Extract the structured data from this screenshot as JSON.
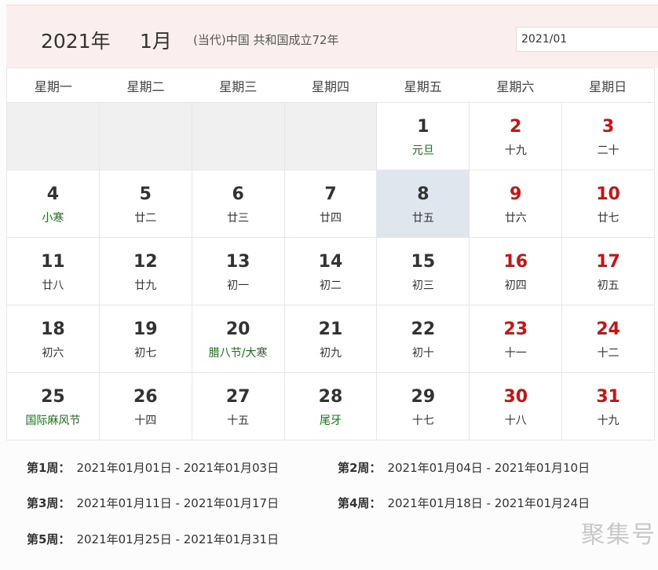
{
  "header": {
    "year": "2021年",
    "month": "1月",
    "era": "(当代)中国 共和国成立72年",
    "picker_value": "2021/01"
  },
  "weekdays": [
    "星期一",
    "星期二",
    "星期三",
    "星期四",
    "星期五",
    "星期六",
    "星期日"
  ],
  "days": [
    {
      "day": "",
      "lunar": ""
    },
    {
      "day": "",
      "lunar": ""
    },
    {
      "day": "",
      "lunar": ""
    },
    {
      "day": "",
      "lunar": ""
    },
    {
      "day": "1",
      "lunar": "元旦",
      "festival": true
    },
    {
      "day": "2",
      "lunar": "十九",
      "weekend": true
    },
    {
      "day": "3",
      "lunar": "二十",
      "weekend": true
    },
    {
      "day": "4",
      "lunar": "小寒",
      "festival": true
    },
    {
      "day": "5",
      "lunar": "廿二"
    },
    {
      "day": "6",
      "lunar": "廿三"
    },
    {
      "day": "7",
      "lunar": "廿四"
    },
    {
      "day": "8",
      "lunar": "廿五",
      "today": true
    },
    {
      "day": "9",
      "lunar": "廿六",
      "weekend": true
    },
    {
      "day": "10",
      "lunar": "廿七",
      "weekend": true
    },
    {
      "day": "11",
      "lunar": "廿八"
    },
    {
      "day": "12",
      "lunar": "廿九"
    },
    {
      "day": "13",
      "lunar": "初一"
    },
    {
      "day": "14",
      "lunar": "初二"
    },
    {
      "day": "15",
      "lunar": "初三"
    },
    {
      "day": "16",
      "lunar": "初四",
      "weekend": true
    },
    {
      "day": "17",
      "lunar": "初五",
      "weekend": true
    },
    {
      "day": "18",
      "lunar": "初六"
    },
    {
      "day": "19",
      "lunar": "初七"
    },
    {
      "day": "20",
      "lunar": "腊八节/大寒",
      "festival": true
    },
    {
      "day": "21",
      "lunar": "初九"
    },
    {
      "day": "22",
      "lunar": "初十"
    },
    {
      "day": "23",
      "lunar": "十一",
      "weekend": true
    },
    {
      "day": "24",
      "lunar": "十二",
      "weekend": true
    },
    {
      "day": "25",
      "lunar": "国际麻风节",
      "festival": true
    },
    {
      "day": "26",
      "lunar": "十四"
    },
    {
      "day": "27",
      "lunar": "十五"
    },
    {
      "day": "28",
      "lunar": "尾牙",
      "festival": true
    },
    {
      "day": "29",
      "lunar": "十七"
    },
    {
      "day": "30",
      "lunar": "十八",
      "weekend": true
    },
    {
      "day": "31",
      "lunar": "十九",
      "weekend": true
    }
  ],
  "weeks": [
    {
      "label": "第1周：",
      "range": "2021年01月01日 - 2021年01月03日"
    },
    {
      "label": "第2周：",
      "range": "2021年01月04日 - 2021年01月10日"
    },
    {
      "label": "第3周：",
      "range": "2021年01月11日 - 2021年01月17日"
    },
    {
      "label": "第4周：",
      "range": "2021年01月18日 - 2021年01月24日"
    },
    {
      "label": "第5周：",
      "range": "2021年01月25日 - 2021年01月31日"
    }
  ],
  "watermark": "聚集号",
  "colors": {
    "weekend": "#cc1111",
    "festival": "#117711",
    "today_bg": "#dfe6ee",
    "header_bg": "#fbeeee"
  }
}
